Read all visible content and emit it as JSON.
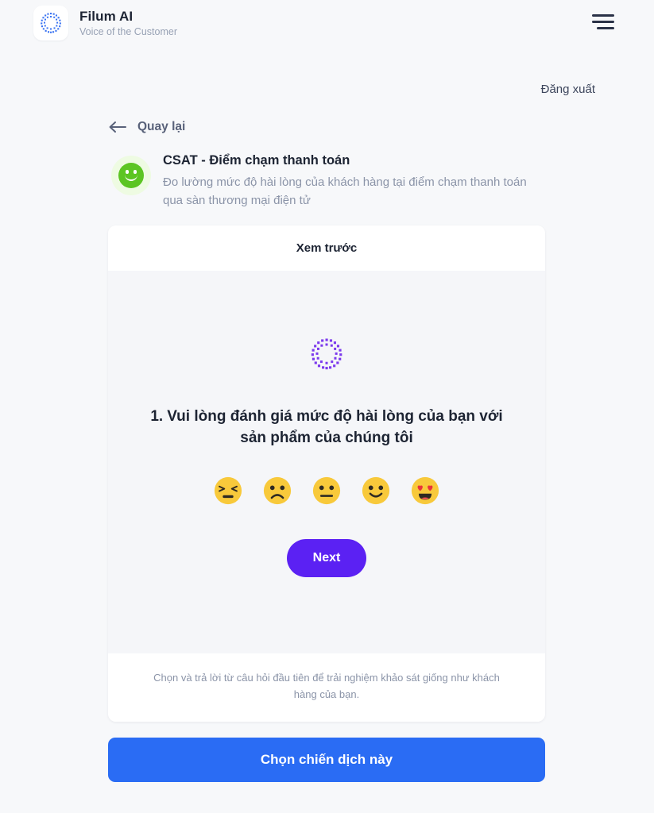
{
  "brand": {
    "name": "Filum AI",
    "tagline": "Voice of the Customer",
    "logo_icon": "dot-circle-logo-icon",
    "menu_icon": "hamburger-menu-icon"
  },
  "header": {
    "logout_label": "Đăng xuất"
  },
  "nav": {
    "back_label": "Quay lại",
    "back_icon": "arrow-left-icon"
  },
  "campaign": {
    "badge_icon": "green-smiley-face-icon",
    "badge_color": "#5cc523",
    "badge_bg": "#eefbe2",
    "title": "CSAT - Điểm chạm thanh toán",
    "description": "Đo lường mức độ hài lòng của khách hàng tại điểm chạm thanh toán qua sàn thương mại điện tử"
  },
  "preview": {
    "header_label": "Xem trước",
    "survey_logo_icon": "dot-circle-logo-icon",
    "survey_logo_color": "#7c3aed",
    "question_number": "1.",
    "question_text": "Vui lòng đánh giá mức độ hài lòng của bạn với sản phẩm của chúng tôi",
    "rating_options": [
      {
        "value": 1,
        "icon": "persevering-face-emoji",
        "glyph": "😣"
      },
      {
        "value": 2,
        "icon": "frowning-face-emoji",
        "glyph": "🙁"
      },
      {
        "value": 3,
        "icon": "neutral-face-emoji",
        "glyph": "😐"
      },
      {
        "value": 4,
        "icon": "slightly-smiling-face-emoji",
        "glyph": "🙂"
      },
      {
        "value": 5,
        "icon": "smiling-face-with-heart-eyes-emoji",
        "glyph": "😍"
      }
    ],
    "next_label": "Next",
    "next_color": "#5b21f3",
    "footer_hint": "Chọn và trả lời từ câu hỏi đầu tiên để trải nghiệm khảo sát giống như khách hàng của bạn."
  },
  "cta": {
    "label": "Chọn chiến dịch này",
    "color": "#2a6cf4"
  }
}
